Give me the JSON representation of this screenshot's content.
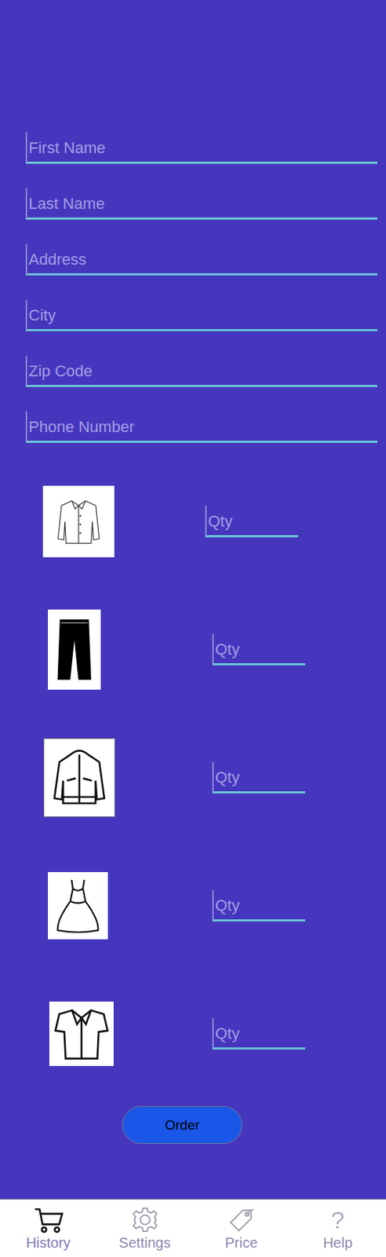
{
  "form": {
    "fields": [
      {
        "placeholder": "First Name"
      },
      {
        "placeholder": "Last Name"
      },
      {
        "placeholder": "Address"
      },
      {
        "placeholder": "City"
      },
      {
        "placeholder": "Zip Code"
      },
      {
        "placeholder": "Phone Number"
      }
    ]
  },
  "items": [
    {
      "qty_placeholder": "Qty"
    },
    {
      "qty_placeholder": "Qty"
    },
    {
      "qty_placeholder": "Qty"
    },
    {
      "qty_placeholder": "Qty"
    },
    {
      "qty_placeholder": "Qty"
    }
  ],
  "order_button": "Order",
  "nav": [
    {
      "label": "History",
      "selected": true,
      "glyph": ""
    },
    {
      "label": "Settings",
      "selected": false,
      "glyph": ""
    },
    {
      "label": "Price",
      "selected": false,
      "glyph": ""
    },
    {
      "label": "Help",
      "selected": false,
      "glyph": "?"
    }
  ]
}
